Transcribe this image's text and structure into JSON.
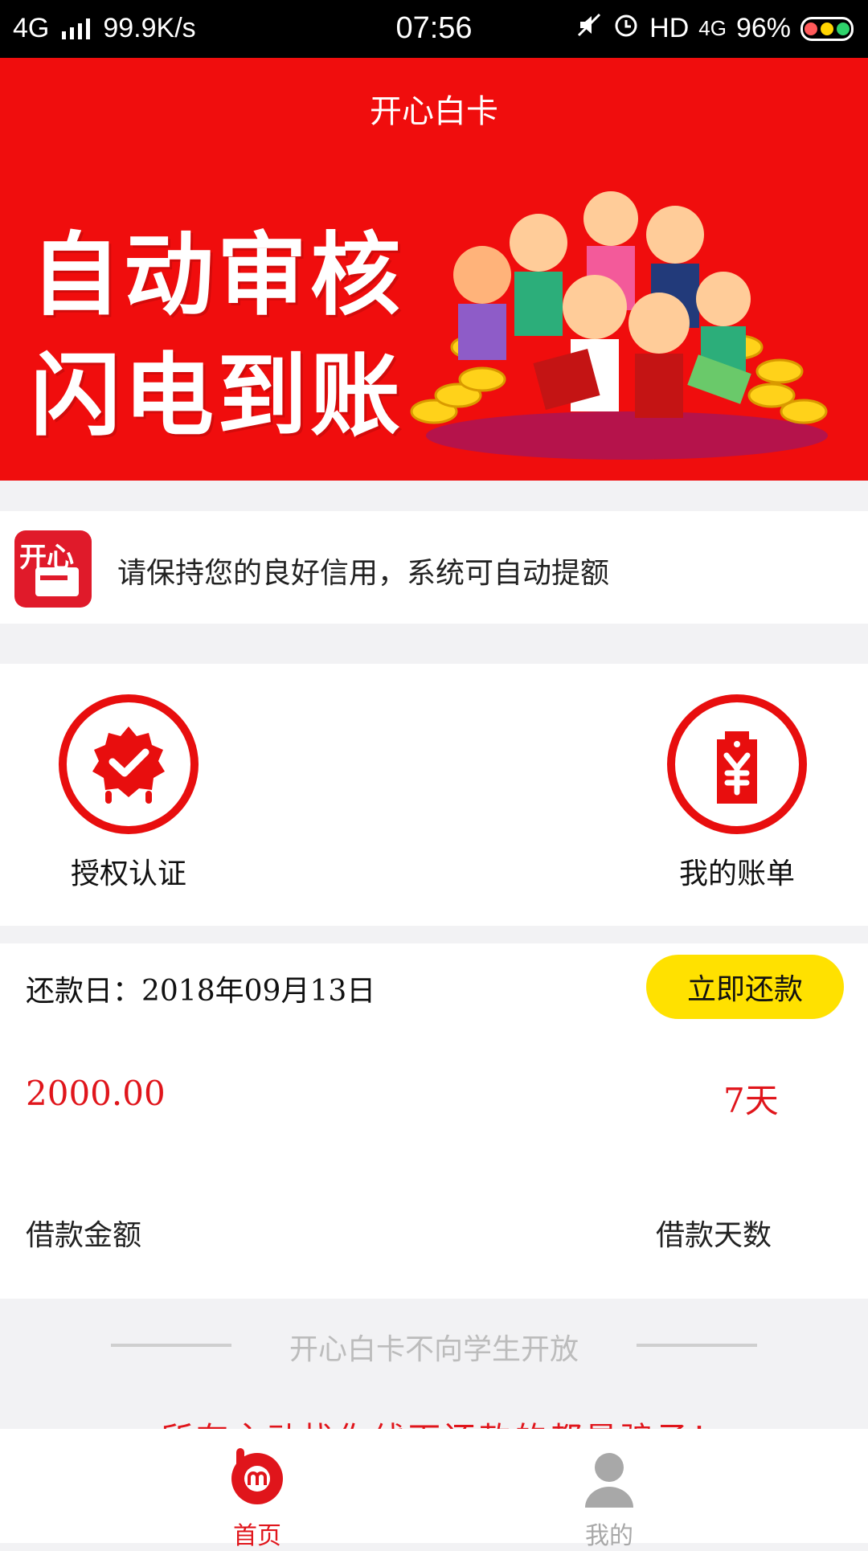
{
  "status_bar": {
    "network": "4G",
    "speed": "99.9K/s",
    "time": "07:56",
    "hd": "HD",
    "network2": "4G",
    "battery": "96%"
  },
  "header": {
    "title": "开心白卡",
    "slogan_line1": "自动审核",
    "slogan_line2": "闪电到账"
  },
  "notice": {
    "app_logo_text": "开心",
    "text": "请保持您的良好信用，系统可自动提额"
  },
  "actions": {
    "left_label": "授权认证",
    "right_label": "我的账单"
  },
  "loan": {
    "due_label": "还款日：",
    "due_date": "2018年09月13日",
    "pay_button": "立即还款",
    "amount": "2000.00",
    "days": "7天",
    "amount_label": "借款金额",
    "days_label": "借款天数"
  },
  "footer_note": {
    "text": "开心白卡不向学生开放",
    "peek_text": "所有主动找你线下还款的都是骗子！"
  },
  "tabbar": {
    "home_label": "首页",
    "me_label": "我的"
  },
  "colors": {
    "primary_red": "#f00d0d",
    "button_yellow": "#ffe100",
    "amount_red": "#e0151b"
  }
}
